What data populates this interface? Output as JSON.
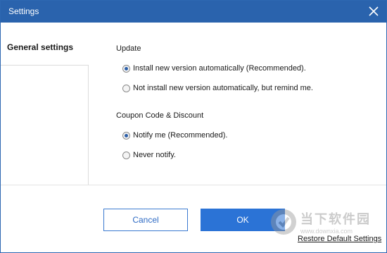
{
  "window": {
    "title": "Settings",
    "close_icon": "close-icon"
  },
  "sidebar": {
    "items": [
      {
        "label": "General settings",
        "selected": true
      }
    ]
  },
  "sections": {
    "update": {
      "heading": "Update",
      "options": [
        {
          "label": "Install new version automatically (Recommended).",
          "checked": true
        },
        {
          "label": "Not install new version automatically, but remind me.",
          "checked": false
        }
      ]
    },
    "coupon": {
      "heading": "Coupon Code & Discount",
      "options": [
        {
          "label": "Notify me (Recommended).",
          "checked": true
        },
        {
          "label": "Never notify.",
          "checked": false
        }
      ]
    }
  },
  "footer": {
    "cancel_label": "Cancel",
    "ok_label": "OK",
    "restore_label": "Restore Default Settings"
  },
  "watermark": {
    "text": "当下软件园",
    "url": "www.downxia.com"
  },
  "colors": {
    "titlebar": "#2a63ad",
    "accent": "#2b73d6"
  }
}
